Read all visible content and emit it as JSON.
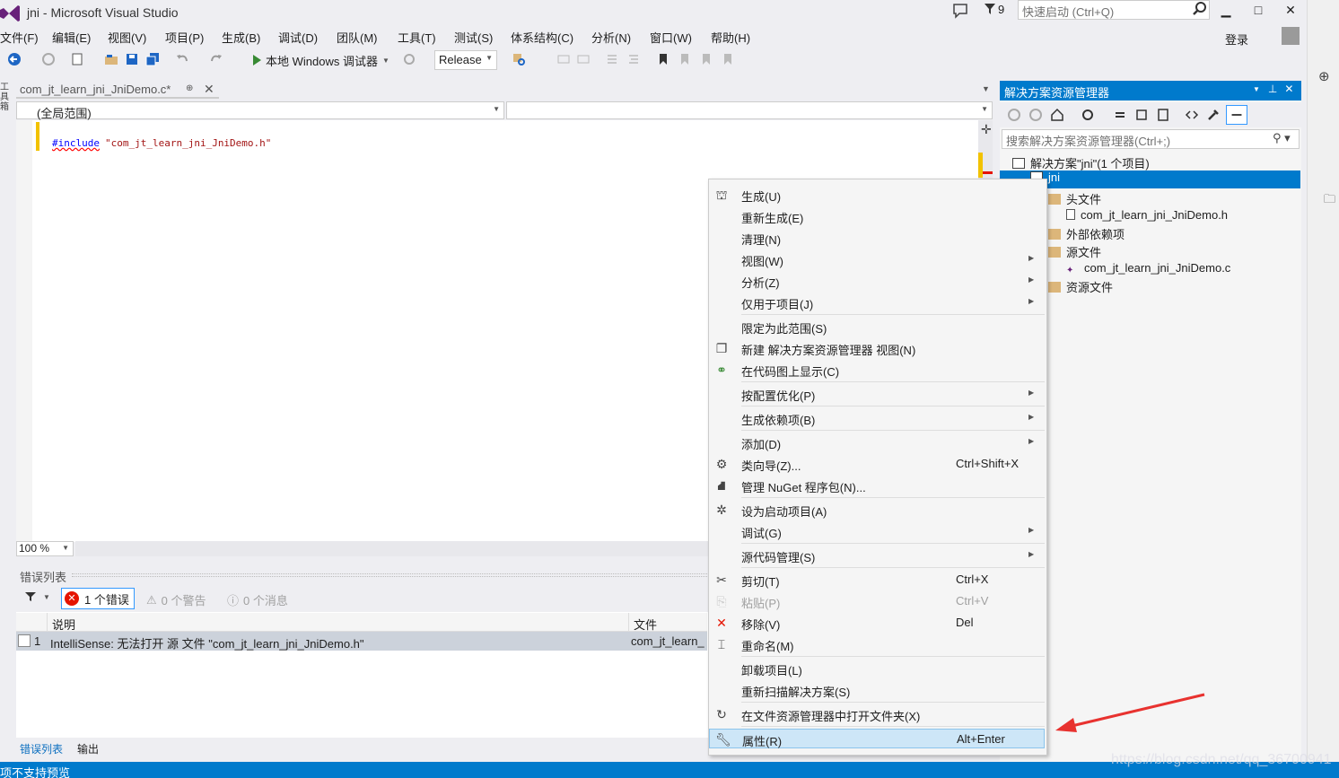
{
  "app": {
    "title": "jni - Microsoft Visual Studio",
    "notification_count": "9",
    "quick_launch_placeholder": "快速启动 (Ctrl+Q)",
    "signin": "登录"
  },
  "window_controls": {
    "minimize": "▁",
    "maximize": "□",
    "close": "✕"
  },
  "menu": [
    "文件(F)",
    "编辑(E)",
    "视图(V)",
    "项目(P)",
    "生成(B)",
    "调试(D)",
    "团队(M)",
    "工具(T)",
    "测试(S)",
    "体系结构(C)",
    "分析(N)",
    "窗口(W)",
    "帮助(H)"
  ],
  "toolbar": {
    "run_label": "本地 Windows 调试器",
    "configuration": "Release"
  },
  "left_strip": {
    "label": "工具箱"
  },
  "editor": {
    "tab_title": "com_jt_learn_jni_JniDemo.c*",
    "scope": "(全局范围)",
    "member": "",
    "code_keyword": "#include",
    "code_string": "\"com_jt_learn_jni_JniDemo.h\"",
    "zoom": "100 %"
  },
  "error_list": {
    "title": "错误列表",
    "errors": "1 个错误",
    "warnings": "0 个警告",
    "messages": "0 个消息",
    "columns": {
      "description": "说明",
      "file": "文件"
    },
    "rows": [
      {
        "num": "1",
        "description": "IntelliSense:  无法打开 源 文件 \"com_jt_learn_jni_JniDemo.h\"",
        "file": "com_jt_learn_"
      }
    ],
    "tabs": {
      "errorlist": "错误列表",
      "output": "输出"
    }
  },
  "solution_explorer": {
    "title": "解决方案资源管理器",
    "search_placeholder": "搜索解决方案资源管理器(Ctrl+;)",
    "tree": {
      "solution": "解决方案\"jni\"(1 个项目)",
      "project": "jni",
      "headers": "头文件",
      "header_file": "com_jt_learn_jni_JniDemo.h",
      "external": "外部依赖项",
      "sources": "源文件",
      "source_file": "com_jt_learn_jni_JniDemo.c",
      "resources": "资源文件"
    }
  },
  "context_menu": {
    "build": "生成(U)",
    "rebuild": "重新生成(E)",
    "clean": "清理(N)",
    "view": "视图(W)",
    "analyze": "分析(Z)",
    "project_only": "仅用于项目(J)",
    "scope_to_this": "限定为此范围(S)",
    "new_se_view": "新建 解决方案资源管理器 视图(N)",
    "show_on_codemap": "在代码图上显示(C)",
    "pgo": "按配置优化(P)",
    "build_deps": "生成依赖项(B)",
    "add": "添加(D)",
    "class_wizard": "类向导(Z)...",
    "class_wizard_shortcut": "Ctrl+Shift+X",
    "nuget": "管理 NuGet 程序包(N)...",
    "set_startup": "设为启动项目(A)",
    "debug": "调试(G)",
    "source_control": "源代码管理(S)",
    "cut": "剪切(T)",
    "cut_shortcut": "Ctrl+X",
    "paste": "粘贴(P)",
    "paste_shortcut": "Ctrl+V",
    "remove": "移除(V)",
    "remove_shortcut": "Del",
    "rename": "重命名(M)",
    "unload": "卸载项目(L)",
    "rescan": "重新扫描解决方案(S)",
    "open_in_explorer": "在文件资源管理器中打开文件夹(X)",
    "properties": "属性(R)",
    "properties_shortcut": "Alt+Enter"
  },
  "status_bar": {
    "text": "项不支持预览"
  },
  "watermark": "https://blog.csdn.net/qq_36700941",
  "colors": {
    "accent": "#007acc",
    "error": "#e51400",
    "annotation_arrow": "#e8322f",
    "highlight": "#cde6f7"
  }
}
